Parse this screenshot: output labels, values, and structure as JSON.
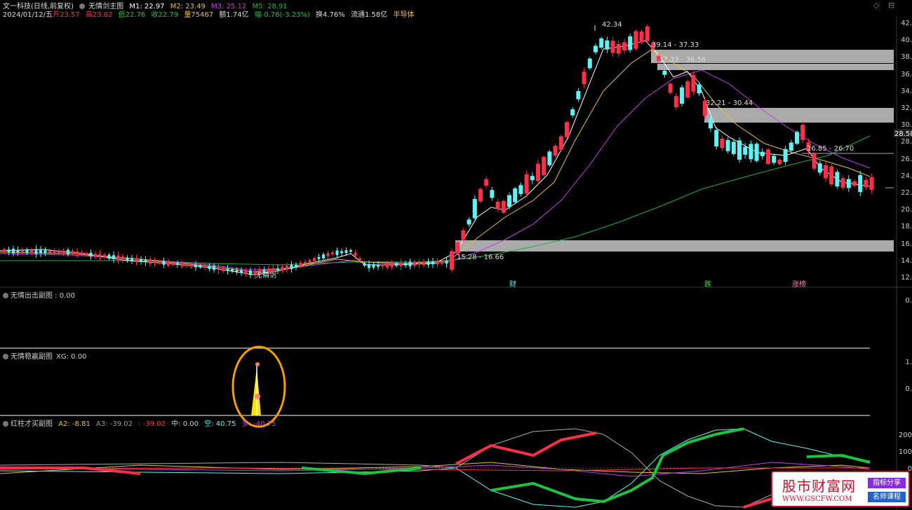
{
  "header": {
    "stock": "文一科技(日线,前复权)",
    "indicator": "无情剑主图",
    "m1": "M1: 22.97",
    "m2": "M2: 23.49",
    "m3": "M3: 25.12",
    "m5": "M5: 28.91",
    "date": "2024/01/12/五",
    "open": "开23.57",
    "high": "高23.62",
    "low": "低22.76",
    "close": "收22.79",
    "volume": "量75467",
    "amount": "额1.74亿",
    "change": "幅-0.76(-3.23%)",
    "turnover": "换4.76%",
    "float": "流通1.58亿",
    "sector": "半导体"
  },
  "colors": {
    "up": "#ff2f4a",
    "down": "#5ff4f4",
    "m1": "#ffffff",
    "m2": "#e8c040",
    "m3": "#c040e0",
    "m5": "#20b040",
    "zone": "#aaaaaa"
  },
  "main_chart": {
    "price_labels": [
      "42.34",
      "39.14 - 37.33",
      "37.33 - 36.56",
      "32.21 - 30.44",
      "26.85 - 26.70",
      "15.28 - 16.66"
    ],
    "current_price": "28.58",
    "y_ticks": [
      "42.",
      "40.",
      "38.",
      "36.",
      "34.",
      "32.",
      "30.",
      "28.",
      "26.",
      "24.",
      "22.",
      "20.",
      "18.",
      "16.",
      "14.",
      "12."
    ],
    "annotations": [
      "无情剑",
      "财",
      "跌",
      "涨榜"
    ]
  },
  "panel1": {
    "title": "无情出击副图 : 0.00",
    "axis": "0."
  },
  "panel2": {
    "title": "无情稳赢副图",
    "xg": "XG: 0.00",
    "axis_top": "1.",
    "axis_bottom": "0."
  },
  "panel3": {
    "title": "红柱才买副图",
    "a2": "A2: -8.81",
    "a3": "A3: -39.02",
    "a3b": ": -39.02",
    "mid": "中: 0.00",
    "kong": "空: 40.75",
    "duo": "多: -40.75",
    "y_ticks": [
      "200",
      "100",
      "0"
    ]
  },
  "watermark": {
    "name": "股市财富网",
    "url": "WWW.GSCFW.COM",
    "tag1": "指标分享",
    "tag2": "名师课程"
  }
}
